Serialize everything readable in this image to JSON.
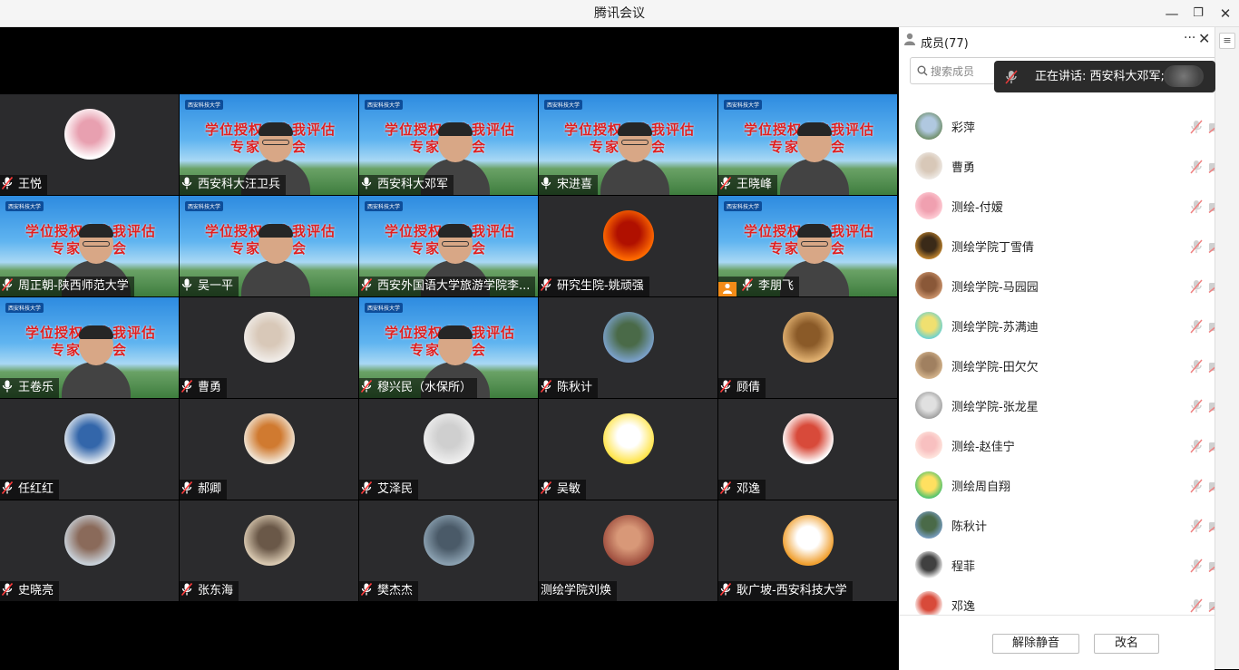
{
  "window": {
    "title": "腾讯会议",
    "minimize": "—",
    "restore": "❐",
    "close": "✕"
  },
  "banner": {
    "line1": "学位授权点自我评估",
    "line2": "专家评审会",
    "logo": "西安科技大学"
  },
  "tiles": [
    {
      "name": "王悦",
      "type": "avatar",
      "colors": [
        "#ffffff",
        "#e8a0b0"
      ]
    },
    {
      "name": "西安科大汪卫兵",
      "type": "banner",
      "mic": "on"
    },
    {
      "name": "西安科大邓军",
      "type": "banner",
      "mic": "on"
    },
    {
      "name": "宋进喜",
      "type": "banner",
      "mic": "on"
    },
    {
      "name": "王晓峰",
      "type": "banner",
      "mic": "off"
    },
    {
      "name": "周正朝-陕西师范大学",
      "type": "banner",
      "mic": "off"
    },
    {
      "name": "吴一平",
      "type": "banner",
      "mic": "on"
    },
    {
      "name": "西安外国语大学旅游学院李...",
      "type": "banner",
      "mic": "off"
    },
    {
      "name": "研究生院-姚顽强",
      "type": "avatar",
      "colors": [
        "#ff6a00",
        "#b01000"
      ]
    },
    {
      "name": "李朋飞",
      "type": "banner",
      "mic": "off",
      "host": true
    },
    {
      "name": "王卷乐",
      "type": "banner",
      "mic": "on"
    },
    {
      "name": "曹勇",
      "type": "avatar",
      "colors": [
        "#f0ece8",
        "#d8c8b8"
      ]
    },
    {
      "name": "穆兴民（水保所）",
      "type": "banner",
      "mic": "off"
    },
    {
      "name": "陈秋计",
      "type": "avatar",
      "colors": [
        "#7aa0c8",
        "#4a6a48"
      ]
    },
    {
      "name": "顾倩",
      "type": "avatar",
      "colors": [
        "#e0b070",
        "#8a5a28"
      ]
    },
    {
      "name": "任红红",
      "type": "avatar",
      "colors": [
        "#dfe6ee",
        "#3366aa"
      ]
    },
    {
      "name": "郝卿",
      "type": "avatar",
      "colors": [
        "#f0e4d4",
        "#d07a30"
      ]
    },
    {
      "name": "艾泽民",
      "type": "avatar",
      "colors": [
        "#eeeeee",
        "#cfcfcf"
      ]
    },
    {
      "name": "吴敏",
      "type": "avatar",
      "colors": [
        "#ffe44a",
        "#ffffff"
      ]
    },
    {
      "name": "邓逸",
      "type": "avatar",
      "colors": [
        "#ffffff",
        "#d84a3a"
      ]
    },
    {
      "name": "史晓亮",
      "type": "avatar",
      "colors": [
        "#c8d0d8",
        "#8a6a5a"
      ]
    },
    {
      "name": "张东海",
      "type": "avatar",
      "colors": [
        "#d8c8b0",
        "#6a5848"
      ]
    },
    {
      "name": "樊杰杰",
      "type": "avatar",
      "colors": [
        "#8aa0b0",
        "#4a5a68"
      ]
    },
    {
      "name": "测绘学院刘焕",
      "type": "avatar",
      "colors": [
        "#a05040",
        "#d89878"
      ],
      "noMic": true
    },
    {
      "name": "耿广坡-西安科技大学",
      "type": "avatar",
      "colors": [
        "#f0a030",
        "#ffffff"
      ]
    }
  ],
  "panel": {
    "title": "成员(77)",
    "more": "···",
    "close": "✕",
    "search_placeholder": "搜索成员",
    "speaking": "正在讲话: 西安科大邓军;",
    "members": [
      {
        "name": "彩萍",
        "colors": [
          "#6a8a60",
          "#b0c8e0"
        ]
      },
      {
        "name": "曹勇",
        "colors": [
          "#f0ece8",
          "#d8c8b8"
        ]
      },
      {
        "name": "测绘-付嫒",
        "colors": [
          "#ffd0d8",
          "#f0a0b0"
        ]
      },
      {
        "name": "测绘学院丁雪倩",
        "colors": [
          "#c88a30",
          "#3a2a18"
        ]
      },
      {
        "name": "测绘学院-马园园",
        "colors": [
          "#d09870",
          "#8a5838"
        ]
      },
      {
        "name": "测绘学院-苏满迪",
        "colors": [
          "#60d0d8",
          "#f0e070"
        ]
      },
      {
        "name": "测绘学院-田欠欠",
        "colors": [
          "#d8b890",
          "#a08060"
        ]
      },
      {
        "name": "测绘学院-张龙星",
        "colors": [
          "#9a9a9a",
          "#e0e0e0"
        ]
      },
      {
        "name": "测绘-赵佳宁",
        "colors": [
          "#ffe8e0",
          "#f8c0c0"
        ]
      },
      {
        "name": "测绘周自翔",
        "colors": [
          "#40c070",
          "#ffe060"
        ]
      },
      {
        "name": "陈秋计",
        "colors": [
          "#7aa0c8",
          "#4a6a48"
        ]
      },
      {
        "name": "程菲",
        "colors": [
          "#ffffff",
          "#404040"
        ]
      },
      {
        "name": "邓逸",
        "colors": [
          "#ffffff",
          "#d84a3a"
        ]
      }
    ],
    "unmute_btn": "解除静音",
    "rename_btn": "改名"
  }
}
